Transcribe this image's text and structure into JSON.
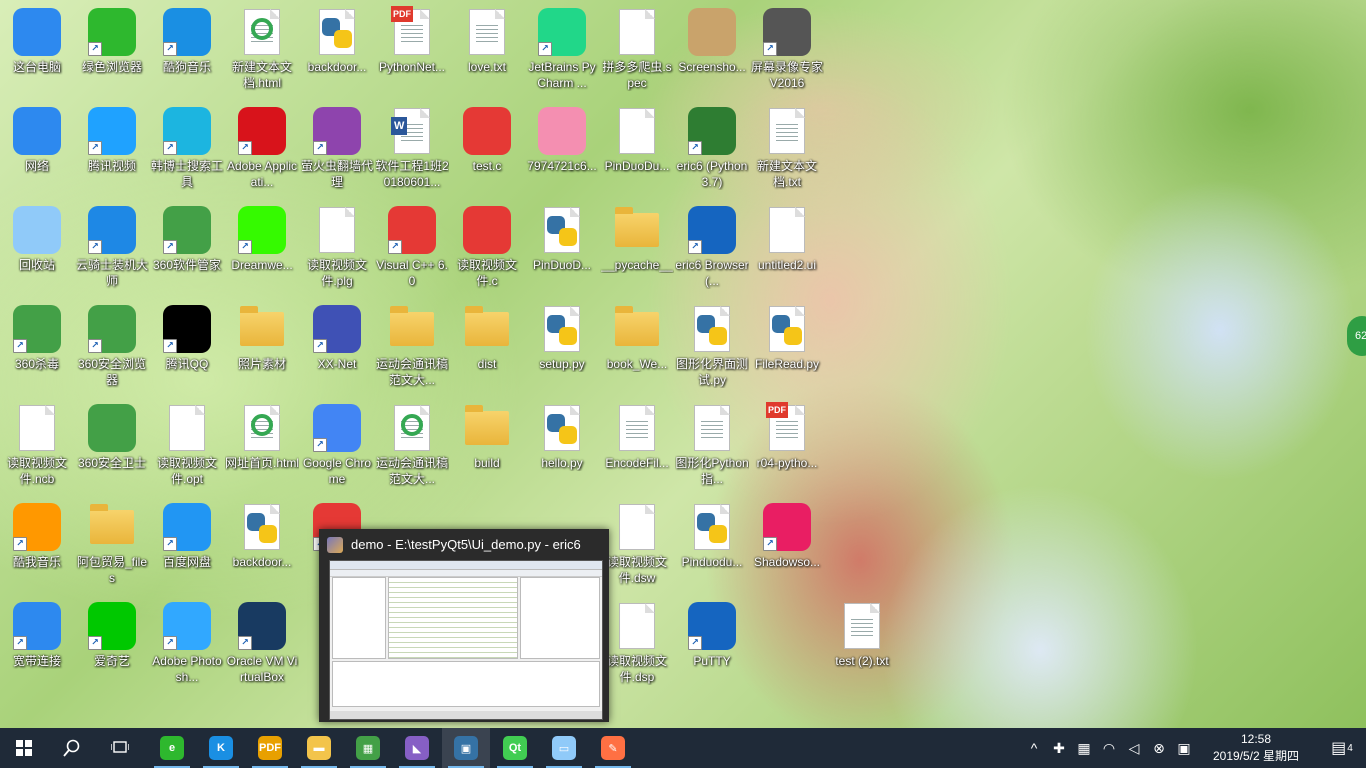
{
  "desktop_icons": [
    {
      "label": "这台电脑",
      "icon": "computer-icon",
      "color": "#2d89ef",
      "shortcut": false
    },
    {
      "label": "绿色浏览器",
      "icon": "green-browser-icon",
      "color": "#2eb82e",
      "shortcut": true
    },
    {
      "label": "酷狗音乐",
      "icon": "kugou-icon",
      "color": "#1a8fe3",
      "shortcut": true
    },
    {
      "label": "新建文本文档.html",
      "icon": "ie-html-icon",
      "color": "#35a853",
      "shortcut": false
    },
    {
      "label": "backdoor...",
      "icon": "python-file-icon",
      "color": "#3572a5",
      "shortcut": false
    },
    {
      "label": "PythonNet...",
      "icon": "pdf-icon",
      "color": "#e03a2d",
      "shortcut": false
    },
    {
      "label": "love.txt",
      "icon": "text-file-icon",
      "color": "#ffffff",
      "shortcut": false
    },
    {
      "label": "JetBrains PyCharm ...",
      "icon": "pycharm-icon",
      "color": "#21d789",
      "shortcut": true
    },
    {
      "label": "拼多多爬虫.spec",
      "icon": "blank-file-icon",
      "color": "#ffffff",
      "shortcut": false
    },
    {
      "label": "Screensho...",
      "icon": "screenshot-icon",
      "color": "#c9a36b",
      "shortcut": false
    },
    {
      "label": "屏幕录像专家V2016",
      "icon": "recorder-icon",
      "color": "#555555",
      "shortcut": true
    },
    {
      "label": "网络",
      "icon": "network-icon",
      "color": "#2d89ef",
      "shortcut": false
    },
    {
      "label": "腾讯视频",
      "icon": "tencent-video-icon",
      "color": "#1fa2ff",
      "shortcut": true
    },
    {
      "label": "韩博士搜索工具",
      "icon": "search-tool-icon",
      "color": "#1cb5e0",
      "shortcut": true
    },
    {
      "label": "Adobe Applicati...",
      "icon": "adobe-icon",
      "color": "#d8131b",
      "shortcut": true
    },
    {
      "label": "萤火虫翻墙代理",
      "icon": "firefly-icon",
      "color": "#8e44ad",
      "shortcut": true
    },
    {
      "label": "软件工程1班20180601...",
      "icon": "word-doc-icon",
      "color": "#2b579a",
      "shortcut": false
    },
    {
      "label": "test.c",
      "icon": "c-file-icon",
      "color": "#e53935",
      "shortcut": false
    },
    {
      "label": "7974721c6...",
      "icon": "image-file-icon",
      "color": "#f48fb1",
      "shortcut": false
    },
    {
      "label": "PinDuoDu...",
      "icon": "blank-file-icon",
      "color": "#ffffff",
      "shortcut": false
    },
    {
      "label": "eric6 (Python 3.7)",
      "icon": "eric-icon",
      "color": "#2e7d32",
      "shortcut": true
    },
    {
      "label": "新建文本文档.txt",
      "icon": "text-file-icon",
      "color": "#ffffff",
      "shortcut": false
    },
    {
      "label": "回收站",
      "icon": "recycle-bin-icon",
      "color": "#90caf9",
      "shortcut": false
    },
    {
      "label": "云骑士装机大师",
      "icon": "knight-icon",
      "color": "#1e88e5",
      "shortcut": true
    },
    {
      "label": "360软件管家",
      "icon": "software-manager-icon",
      "color": "#43a047",
      "shortcut": true
    },
    {
      "label": "Dreamwe...",
      "icon": "dreamweaver-icon",
      "color": "#35fa00",
      "shortcut": true
    },
    {
      "label": "读取视频文件.plg",
      "icon": "blank-file-icon",
      "color": "#ffffff",
      "shortcut": false
    },
    {
      "label": "Visual C++ 6.0",
      "icon": "visual-cpp-icon",
      "color": "#e53935",
      "shortcut": true
    },
    {
      "label": "读取视频文件.c",
      "icon": "c-file-icon",
      "color": "#e53935",
      "shortcut": false
    },
    {
      "label": "PinDuoD...",
      "icon": "python-file-icon",
      "color": "#3572a5",
      "shortcut": false
    },
    {
      "label": "__pycache__",
      "icon": "folder-icon",
      "color": "#f3c44b",
      "shortcut": false
    },
    {
      "label": "eric6 Browser (...",
      "icon": "eric-browser-icon",
      "color": "#1565c0",
      "shortcut": true
    },
    {
      "label": "untitled2.ui",
      "icon": "blank-file-icon",
      "color": "#ffffff",
      "shortcut": false
    },
    {
      "label": "360杀毒",
      "icon": "antivirus-icon",
      "color": "#43a047",
      "shortcut": true
    },
    {
      "label": "360安全浏览器",
      "icon": "safe-browser-icon",
      "color": "#43a047",
      "shortcut": true
    },
    {
      "label": "腾讯QQ",
      "icon": "qq-icon",
      "color": "#000000",
      "shortcut": true
    },
    {
      "label": "照片素材",
      "icon": "folder-icon",
      "color": "#f3c44b",
      "shortcut": false
    },
    {
      "label": "XX-Net",
      "icon": "xxnet-icon",
      "color": "#3f51b5",
      "shortcut": true
    },
    {
      "label": "运动会通讯稿范文大...",
      "icon": "folder-icon",
      "color": "#f3c44b",
      "shortcut": false
    },
    {
      "label": "dist",
      "icon": "folder-icon",
      "color": "#f3c44b",
      "shortcut": false
    },
    {
      "label": "setup.py",
      "icon": "python-file-icon",
      "color": "#3572a5",
      "shortcut": false
    },
    {
      "label": "book_We...",
      "icon": "folder-icon",
      "color": "#f3c44b",
      "shortcut": false
    },
    {
      "label": "图形化界面测试.py",
      "icon": "python-file-icon",
      "color": "#3572a5",
      "shortcut": false
    },
    {
      "label": "FileRead.py",
      "icon": "python-file-icon",
      "color": "#3572a5",
      "shortcut": false
    },
    {
      "label": "读取视频文件.ncb",
      "icon": "blank-file-icon",
      "color": "#ffffff",
      "shortcut": false
    },
    {
      "label": "360安全卫士",
      "icon": "safe-guard-icon",
      "color": "#43a047",
      "shortcut": false
    },
    {
      "label": "读取视频文件.opt",
      "icon": "blank-file-icon",
      "color": "#ffffff",
      "shortcut": false
    },
    {
      "label": "网址首页.html",
      "icon": "ie-html-icon",
      "color": "#35a853",
      "shortcut": false
    },
    {
      "label": "Google Chrome",
      "icon": "chrome-icon",
      "color": "#4285f4",
      "shortcut": true
    },
    {
      "label": "运动会通讯稿范文大...",
      "icon": "ie-html-icon",
      "color": "#35a853",
      "shortcut": false
    },
    {
      "label": "build",
      "icon": "folder-icon",
      "color": "#f3c44b",
      "shortcut": false
    },
    {
      "label": "hello.py",
      "icon": "python-file-icon",
      "color": "#3572a5",
      "shortcut": false
    },
    {
      "label": "EncodeFil...",
      "icon": "text-file-icon",
      "color": "#ffffff",
      "shortcut": false
    },
    {
      "label": "图形化Python指...",
      "icon": "text-file-icon",
      "color": "#ffffff",
      "shortcut": false
    },
    {
      "label": "r04-pytho...",
      "icon": "pdf-icon",
      "color": "#e03a2d",
      "shortcut": false
    },
    {
      "label": "酷我音乐",
      "icon": "kuwo-icon",
      "color": "#ff9800",
      "shortcut": true
    },
    {
      "label": "阿包贸易_files",
      "icon": "folder-icon",
      "color": "#f3c44b",
      "shortcut": false
    },
    {
      "label": "百度网盘",
      "icon": "baidu-netdisk-icon",
      "color": "#2196f3",
      "shortcut": true
    },
    {
      "label": "backdoor...",
      "icon": "python-file-icon",
      "color": "#3572a5",
      "shortcut": false
    },
    {
      "label": "网",
      "icon": "youdao-icon",
      "color": "#e53935",
      "shortcut": true
    },
    {
      "label": "读取视频文件.dsw",
      "icon": "blank-file-icon",
      "color": "#ffffff",
      "shortcut": false
    },
    {
      "label": "Pinduodu...",
      "icon": "python-exe-icon",
      "color": "#3572a5",
      "shortcut": false
    },
    {
      "label": "Shadowso...",
      "icon": "shadowsocks-icon",
      "color": "#e91e63",
      "shortcut": true
    },
    {
      "label": "宽带连接",
      "icon": "broadband-icon",
      "color": "#2d89ef",
      "shortcut": true
    },
    {
      "label": "爱奇艺",
      "icon": "iqiyi-icon",
      "color": "#00c800",
      "shortcut": true
    },
    {
      "label": "Adobe Photosh...",
      "icon": "photoshop-icon",
      "color": "#31a8ff",
      "shortcut": true
    },
    {
      "label": "Oracle VM VirtualBox",
      "icon": "virtualbox-icon",
      "color": "#183a61",
      "shortcut": true
    },
    {
      "label": "读取视频文件.dsp",
      "icon": "blank-file-icon",
      "color": "#ffffff",
      "shortcut": false
    },
    {
      "label": "PuTTY",
      "icon": "putty-icon",
      "color": "#1565c0",
      "shortcut": true
    },
    {
      "label": "test (2).txt",
      "icon": "text-file-icon",
      "color": "#ffffff",
      "shortcut": false
    }
  ],
  "preview": {
    "title": "demo - E:\\testPyQt5\\Ui_demo.py - eric6"
  },
  "taskbar": {
    "start_icon": "windows-start-icon",
    "search_icon": "search-icon",
    "taskview_icon": "task-view-icon",
    "apps": [
      {
        "name": "green-browser",
        "glyph": "e",
        "color": "#2eb82e",
        "running": false
      },
      {
        "name": "kugou",
        "glyph": "K",
        "color": "#1a8fe3",
        "running": false
      },
      {
        "name": "pdf-reader",
        "glyph": "PDF",
        "color": "#e8a000",
        "running": false
      },
      {
        "name": "file-explorer",
        "glyph": "▬",
        "color": "#f3c44b",
        "running": false
      },
      {
        "name": "software-manager",
        "glyph": "▦",
        "color": "#43a047",
        "running": false
      },
      {
        "name": "visual-studio",
        "glyph": "◣",
        "color": "#865fc5",
        "running": false
      },
      {
        "name": "eric6",
        "glyph": "▣",
        "color": "#3572a5",
        "running": true
      },
      {
        "name": "qt-designer",
        "glyph": "Qt",
        "color": "#41cd52",
        "running": false
      },
      {
        "name": "notepad",
        "glyph": "▭",
        "color": "#90caf9",
        "running": false
      },
      {
        "name": "paint",
        "glyph": "✎",
        "color": "#ff7043",
        "running": false
      }
    ],
    "tray_glyphs": [
      "^",
      "✚",
      "▦",
      "◠",
      "◁",
      "⊗",
      "▣"
    ],
    "time": "12:58",
    "date": "2019/5/2 星期四",
    "notification_count": "4"
  },
  "edge_badge": "62"
}
